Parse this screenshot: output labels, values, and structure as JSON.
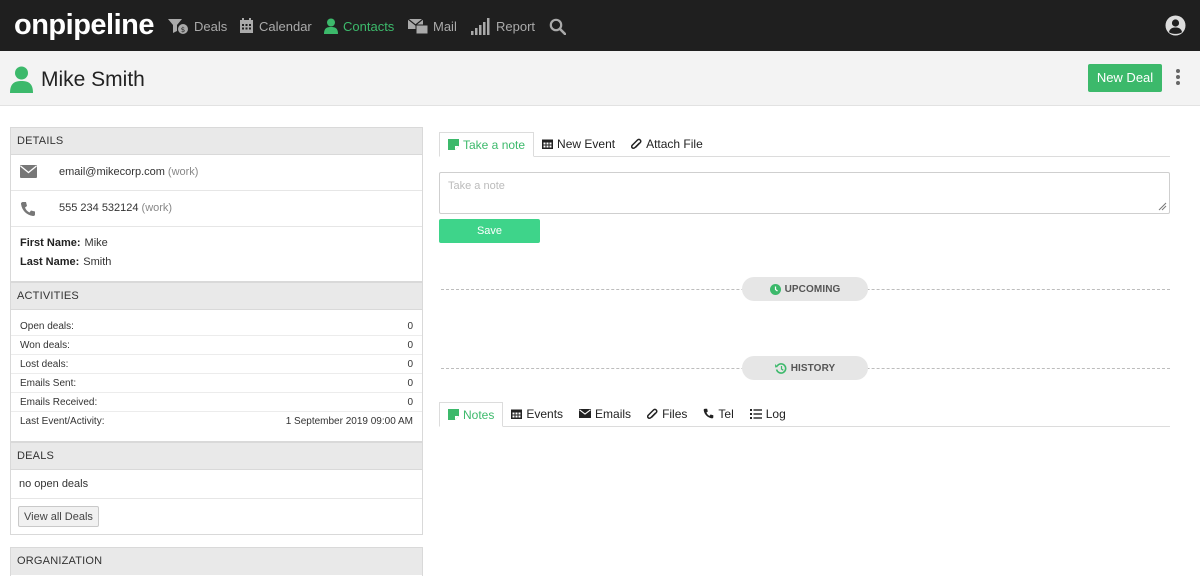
{
  "app": {
    "logo": "onpipeline"
  },
  "nav": {
    "items": [
      {
        "label": "Deals",
        "icon": "deals-filter-icon"
      },
      {
        "label": "Calendar",
        "icon": "calendar-icon"
      },
      {
        "label": "Contacts",
        "icon": "person-icon",
        "active": true
      },
      {
        "label": "Mail",
        "icon": "mail-icon"
      },
      {
        "label": "Report",
        "icon": "bar-chart-icon"
      }
    ],
    "search_icon": "search-icon",
    "user_icon": "user-circle-icon"
  },
  "page": {
    "title": "Mike Smith",
    "new_deal_label": "New Deal"
  },
  "details": {
    "heading": "DETAILS",
    "email": "email@mikecorp.com",
    "email_type": "(work)",
    "phone": "555 234 532124",
    "phone_type": "(work)",
    "first_name_label": "First Name:",
    "first_name": "Mike",
    "last_name_label": "Last Name:",
    "last_name": "Smith"
  },
  "activities": {
    "heading": "ACTIVITIES",
    "rows": [
      {
        "label": "Open deals:",
        "value": "0"
      },
      {
        "label": "Won deals:",
        "value": "0"
      },
      {
        "label": "Lost deals:",
        "value": "0"
      },
      {
        "label": "Emails Sent:",
        "value": "0"
      },
      {
        "label": "Emails Received:",
        "value": "0"
      },
      {
        "label": "Last Event/Activity:",
        "value": "1 September 2019 09:00 AM"
      }
    ]
  },
  "deals": {
    "heading": "DEALS",
    "empty_text": "no open deals",
    "view_all_label": "View all Deals"
  },
  "organization": {
    "heading": "ORGANIZATION"
  },
  "note_tabs": [
    {
      "label": "Take a note",
      "active": true
    },
    {
      "label": "New Event"
    },
    {
      "label": "Attach File"
    }
  ],
  "note": {
    "placeholder": "Take a note",
    "save_label": "Save"
  },
  "upcoming_label": "UPCOMING",
  "history_label": "HISTORY",
  "history_tabs": [
    {
      "label": "Notes",
      "active": true
    },
    {
      "label": "Events"
    },
    {
      "label": "Emails"
    },
    {
      "label": "Files"
    },
    {
      "label": "Tel"
    },
    {
      "label": "Log"
    }
  ],
  "colors": {
    "accent": "#3cb96b",
    "save": "#3ed48a",
    "topbar": "#1f1f1f"
  }
}
